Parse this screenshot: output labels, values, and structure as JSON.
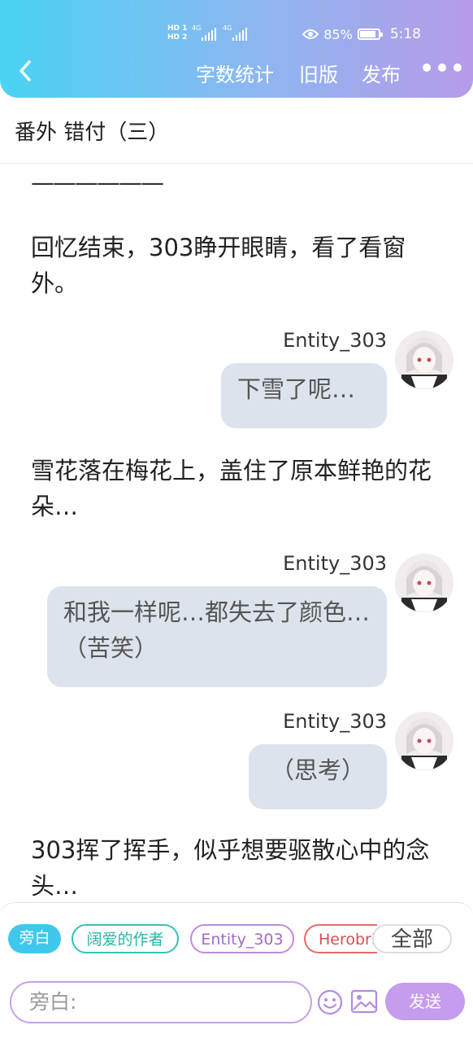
{
  "status_bar": {
    "sig_top": "HD 1",
    "sig_bottom": "HD 2",
    "net1": "4G",
    "net2": "4G",
    "battery": "85%",
    "time": "5:18"
  },
  "nav": {
    "word_count": "字数统计",
    "old_version": "旧版",
    "publish": "发布"
  },
  "chapter_title": "番外 错付（三）",
  "content": {
    "separator": "——————",
    "narration1": "回忆结束，303睁开眼睛，看了看窗外。",
    "msg1": {
      "name": "Entity_303",
      "text": "下雪了呢…"
    },
    "narration2": "雪花落在梅花上，盖住了原本鲜艳的花朵…",
    "msg2": {
      "name": "Entity_303",
      "text": "和我一样呢…都失去了颜色…（苦笑）"
    },
    "msg3": {
      "name": "Entity_303",
      "text": "（思考）"
    },
    "narration3": "303挥了挥手，似乎想要驱散心中的念头…"
  },
  "roles": {
    "narrator": "旁白",
    "author": "阔爱的作者",
    "entity": "Entity_303",
    "herobrine": "Herobrine",
    "all": "全部"
  },
  "composer": {
    "placeholder": "旁白:",
    "send": "发送"
  },
  "colors": {
    "gradient_start": "#49d4f3",
    "gradient_end": "#b79be8",
    "bubble": "#dde3ec",
    "send": "#c59cee"
  }
}
